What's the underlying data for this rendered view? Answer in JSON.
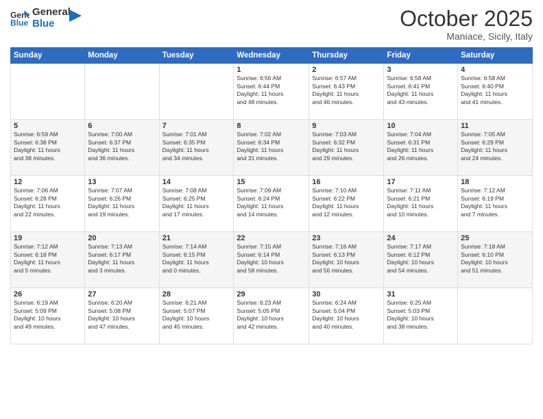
{
  "header": {
    "logo_line1": "General",
    "logo_line2": "Blue",
    "month": "October 2025",
    "location": "Maniace, Sicily, Italy"
  },
  "weekdays": [
    "Sunday",
    "Monday",
    "Tuesday",
    "Wednesday",
    "Thursday",
    "Friday",
    "Saturday"
  ],
  "weeks": [
    [
      {
        "num": "",
        "info": ""
      },
      {
        "num": "",
        "info": ""
      },
      {
        "num": "",
        "info": ""
      },
      {
        "num": "1",
        "info": "Sunrise: 6:56 AM\nSunset: 6:44 PM\nDaylight: 11 hours\nand 48 minutes."
      },
      {
        "num": "2",
        "info": "Sunrise: 6:57 AM\nSunset: 6:43 PM\nDaylight: 11 hours\nand 46 minutes."
      },
      {
        "num": "3",
        "info": "Sunrise: 6:58 AM\nSunset: 6:41 PM\nDaylight: 11 hours\nand 43 minutes."
      },
      {
        "num": "4",
        "info": "Sunrise: 6:58 AM\nSunset: 6:40 PM\nDaylight: 11 hours\nand 41 minutes."
      }
    ],
    [
      {
        "num": "5",
        "info": "Sunrise: 6:59 AM\nSunset: 6:38 PM\nDaylight: 11 hours\nand 38 minutes."
      },
      {
        "num": "6",
        "info": "Sunrise: 7:00 AM\nSunset: 6:37 PM\nDaylight: 11 hours\nand 36 minutes."
      },
      {
        "num": "7",
        "info": "Sunrise: 7:01 AM\nSunset: 6:35 PM\nDaylight: 11 hours\nand 34 minutes."
      },
      {
        "num": "8",
        "info": "Sunrise: 7:02 AM\nSunset: 6:34 PM\nDaylight: 11 hours\nand 31 minutes."
      },
      {
        "num": "9",
        "info": "Sunrise: 7:03 AM\nSunset: 6:32 PM\nDaylight: 11 hours\nand 29 minutes."
      },
      {
        "num": "10",
        "info": "Sunrise: 7:04 AM\nSunset: 6:31 PM\nDaylight: 11 hours\nand 26 minutes."
      },
      {
        "num": "11",
        "info": "Sunrise: 7:05 AM\nSunset: 6:29 PM\nDaylight: 11 hours\nand 24 minutes."
      }
    ],
    [
      {
        "num": "12",
        "info": "Sunrise: 7:06 AM\nSunset: 6:28 PM\nDaylight: 11 hours\nand 22 minutes."
      },
      {
        "num": "13",
        "info": "Sunrise: 7:07 AM\nSunset: 6:26 PM\nDaylight: 11 hours\nand 19 minutes."
      },
      {
        "num": "14",
        "info": "Sunrise: 7:08 AM\nSunset: 6:25 PM\nDaylight: 11 hours\nand 17 minutes."
      },
      {
        "num": "15",
        "info": "Sunrise: 7:09 AM\nSunset: 6:24 PM\nDaylight: 11 hours\nand 14 minutes."
      },
      {
        "num": "16",
        "info": "Sunrise: 7:10 AM\nSunset: 6:22 PM\nDaylight: 11 hours\nand 12 minutes."
      },
      {
        "num": "17",
        "info": "Sunrise: 7:11 AM\nSunset: 6:21 PM\nDaylight: 11 hours\nand 10 minutes."
      },
      {
        "num": "18",
        "info": "Sunrise: 7:12 AM\nSunset: 6:19 PM\nDaylight: 11 hours\nand 7 minutes."
      }
    ],
    [
      {
        "num": "19",
        "info": "Sunrise: 7:12 AM\nSunset: 6:18 PM\nDaylight: 11 hours\nand 5 minutes."
      },
      {
        "num": "20",
        "info": "Sunrise: 7:13 AM\nSunset: 6:17 PM\nDaylight: 11 hours\nand 3 minutes."
      },
      {
        "num": "21",
        "info": "Sunrise: 7:14 AM\nSunset: 6:15 PM\nDaylight: 11 hours\nand 0 minutes."
      },
      {
        "num": "22",
        "info": "Sunrise: 7:15 AM\nSunset: 6:14 PM\nDaylight: 10 hours\nand 58 minutes."
      },
      {
        "num": "23",
        "info": "Sunrise: 7:16 AM\nSunset: 6:13 PM\nDaylight: 10 hours\nand 56 minutes."
      },
      {
        "num": "24",
        "info": "Sunrise: 7:17 AM\nSunset: 6:12 PM\nDaylight: 10 hours\nand 54 minutes."
      },
      {
        "num": "25",
        "info": "Sunrise: 7:18 AM\nSunset: 6:10 PM\nDaylight: 10 hours\nand 51 minutes."
      }
    ],
    [
      {
        "num": "26",
        "info": "Sunrise: 6:19 AM\nSunset: 5:09 PM\nDaylight: 10 hours\nand 49 minutes."
      },
      {
        "num": "27",
        "info": "Sunrise: 6:20 AM\nSunset: 5:08 PM\nDaylight: 10 hours\nand 47 minutes."
      },
      {
        "num": "28",
        "info": "Sunrise: 6:21 AM\nSunset: 5:07 PM\nDaylight: 10 hours\nand 45 minutes."
      },
      {
        "num": "29",
        "info": "Sunrise: 6:23 AM\nSunset: 5:05 PM\nDaylight: 10 hours\nand 42 minutes."
      },
      {
        "num": "30",
        "info": "Sunrise: 6:24 AM\nSunset: 5:04 PM\nDaylight: 10 hours\nand 40 minutes."
      },
      {
        "num": "31",
        "info": "Sunrise: 6:25 AM\nSunset: 5:03 PM\nDaylight: 10 hours\nand 38 minutes."
      },
      {
        "num": "",
        "info": ""
      }
    ]
  ]
}
